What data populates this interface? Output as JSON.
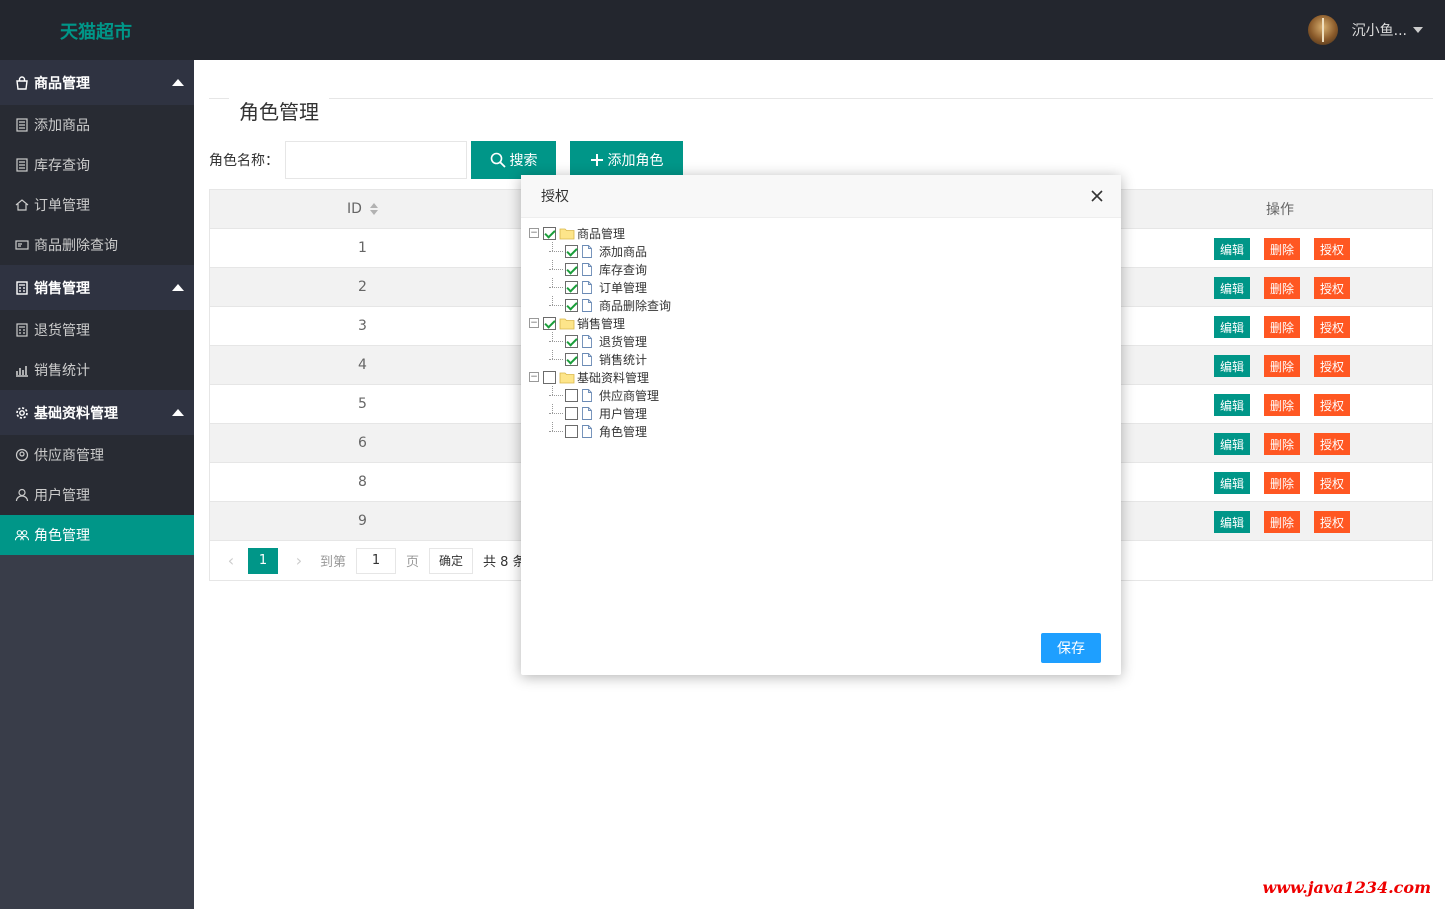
{
  "header": {
    "logo": "天猫超市",
    "username": "沉小鱼..."
  },
  "sidebar": {
    "groups": [
      {
        "label": "商品管理",
        "items": [
          "添加商品",
          "库存查询",
          "订单管理",
          "商品删除查询"
        ]
      },
      {
        "label": "销售管理",
        "items": [
          "退货管理",
          "销售统计"
        ]
      },
      {
        "label": "基础资料管理",
        "items": [
          "供应商管理",
          "用户管理",
          "角色管理"
        ]
      }
    ]
  },
  "page": {
    "title": "角色管理",
    "search_label": "角色名称：",
    "search_placeholder": "",
    "search_button": "搜索",
    "add_button": "添加角色"
  },
  "table": {
    "col_id": "ID",
    "col_op": "操作",
    "rows": [
      "1",
      "2",
      "3",
      "4",
      "5",
      "6",
      "8",
      "9"
    ],
    "btn_edit": "编辑",
    "btn_delete": "删除",
    "btn_auth": "授权"
  },
  "pager": {
    "current": "1",
    "goto_label": "到第",
    "page_input": "1",
    "page_unit": "页",
    "confirm": "确定",
    "total": "共 8 条"
  },
  "modal": {
    "title": "授权",
    "save": "保存",
    "tree": [
      {
        "label": "商品管理",
        "checked": true,
        "children": [
          {
            "label": "添加商品",
            "checked": true
          },
          {
            "label": "库存查询",
            "checked": true
          },
          {
            "label": "订单管理",
            "checked": true
          },
          {
            "label": "商品删除查询",
            "checked": true
          }
        ]
      },
      {
        "label": "销售管理",
        "checked": true,
        "children": [
          {
            "label": "退货管理",
            "checked": true
          },
          {
            "label": "销售统计",
            "checked": true
          }
        ]
      },
      {
        "label": "基础资料管理",
        "checked": false,
        "children": [
          {
            "label": "供应商管理",
            "checked": false
          },
          {
            "label": "用户管理",
            "checked": false
          },
          {
            "label": "角色管理",
            "checked": false
          }
        ]
      }
    ]
  },
  "watermark": "www.java1234.com",
  "colors": {
    "brand": "#009688",
    "danger": "#ff5722",
    "save": "#1e9fff",
    "header_bg": "#23262e",
    "sidebar_bg": "#393d49"
  }
}
